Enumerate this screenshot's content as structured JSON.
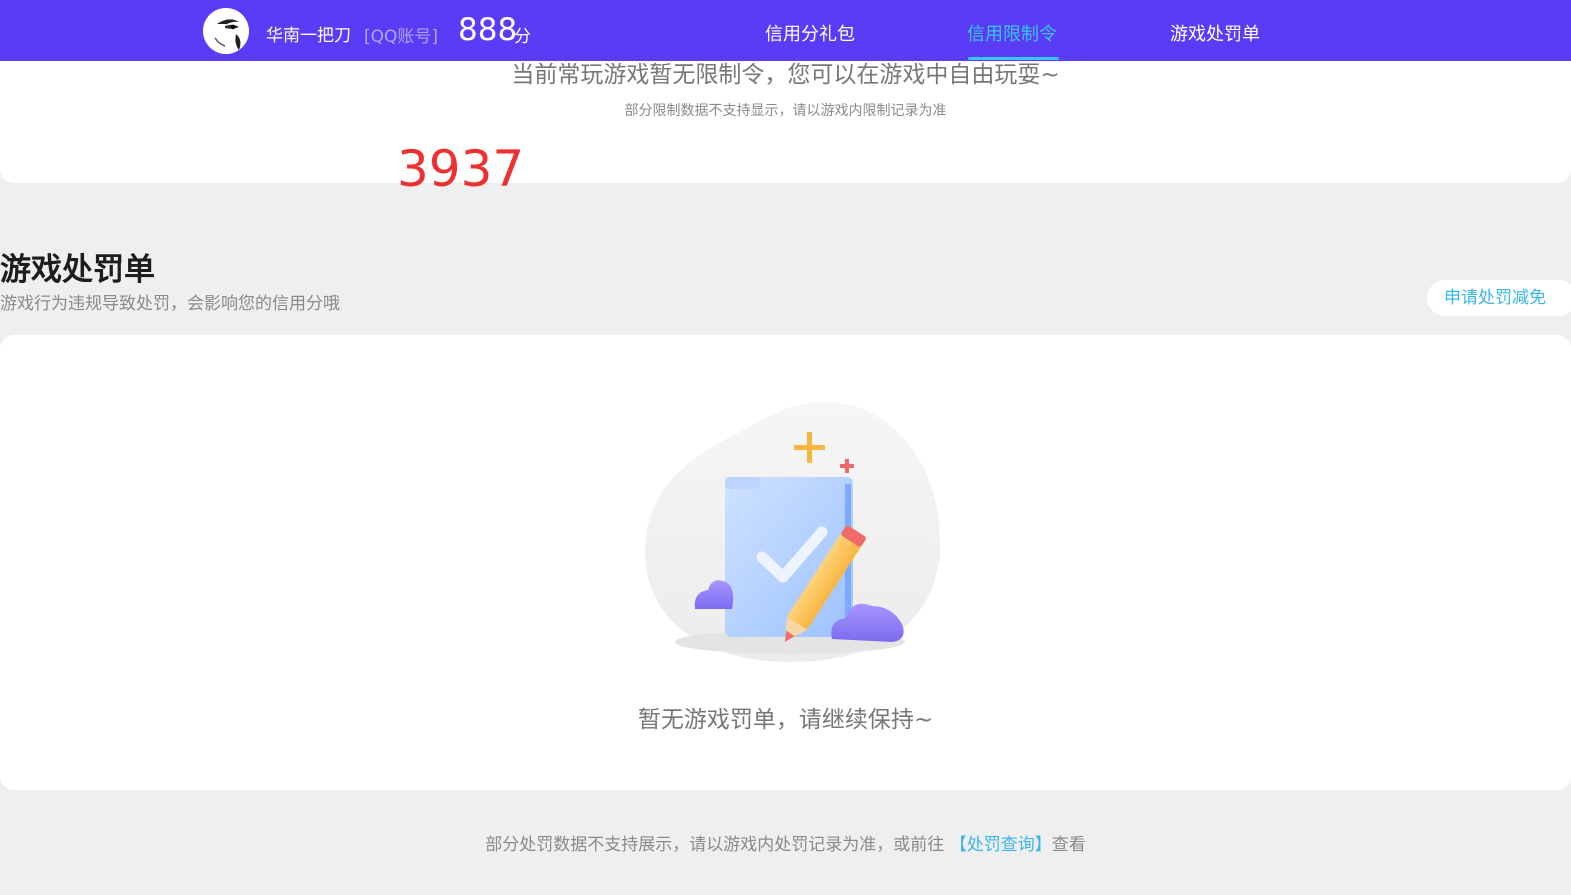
{
  "header": {
    "user_name": "华南一把刀",
    "account_type": "[QQ账号]",
    "score": "888",
    "score_unit": "分",
    "nav": [
      {
        "label": "信用分礼包",
        "active": false
      },
      {
        "label": "信用限制令",
        "active": true
      },
      {
        "label": "游戏处罚单",
        "active": false
      }
    ],
    "active_color": "#39c7f2",
    "bar_color": "#5a3cf7"
  },
  "limit_card": {
    "message": "当前常玩游戏暂无限制令，您可以在游戏中自由玩耍~",
    "note": "部分限制数据不支持显示，请以游戏内限制记录为准"
  },
  "overlay_number": "3937",
  "penalty_section": {
    "title": "游戏处罚单",
    "description": "游戏行为违规导致处罚，会影响您的信用分哦",
    "appeal_button": "申请处罚减免",
    "empty_text": "暂无游戏罚单，请继续保持~"
  },
  "footer": {
    "note_before": "部分处罚数据不支持展示，请以游戏内处罚记录为准，或前往",
    "link": "【处罚查询】",
    "note_after": "查看"
  }
}
